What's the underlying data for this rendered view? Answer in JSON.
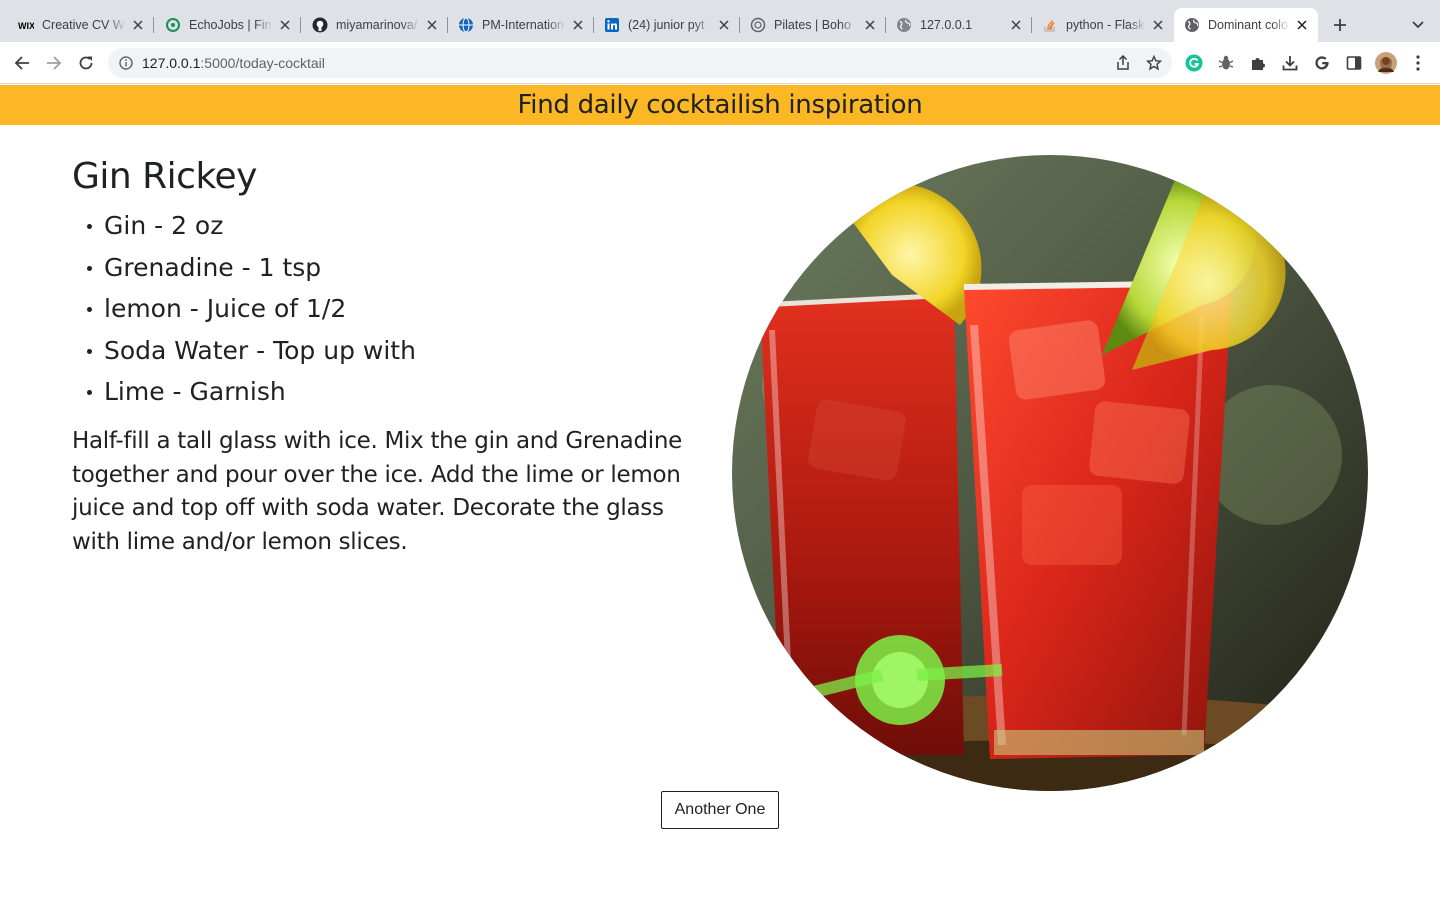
{
  "browser": {
    "tabs": [
      {
        "title": "Creative CV W",
        "icon": "wix-icon"
      },
      {
        "title": "EchoJobs | Fin",
        "icon": "echojobs-icon"
      },
      {
        "title": "miyamarinova/",
        "icon": "github-icon"
      },
      {
        "title": "PM-Internation",
        "icon": "globe-logo-icon"
      },
      {
        "title": "(24) junior pyt",
        "icon": "linkedin-icon"
      },
      {
        "title": "Pilates | Boho",
        "icon": "pilates-icon"
      },
      {
        "title": "127.0.0.1",
        "icon": "globe-icon"
      },
      {
        "title": "python - Flask",
        "icon": "stackoverflow-icon"
      },
      {
        "title": "Dominant colo",
        "icon": "globe-icon"
      }
    ],
    "address": {
      "host": "127.0.0.1",
      "path": ":5000/today-cocktail"
    },
    "colors": {
      "tabstrip": "#dee1e6",
      "omnibox": "#f1f3f4"
    }
  },
  "page": {
    "banner": "Find daily cocktailish inspiration",
    "drink_name": "Gin Rickey",
    "ingredients": [
      "Gin - 2 oz",
      "Grenadine - 1 tsp",
      "lemon - Juice of 1/2",
      "Soda Water - Top up with",
      "Lime - Garnish"
    ],
    "instructions": "Half-fill a tall glass with ice. Mix the gin and Grenadine together and pour over the ice. Add the lime or lemon juice and top off with soda water. Decorate the glass with lime and/or lemon slices.",
    "button_label": "Another One",
    "colors": {
      "banner": "#fbb724",
      "text": "#202124"
    }
  }
}
